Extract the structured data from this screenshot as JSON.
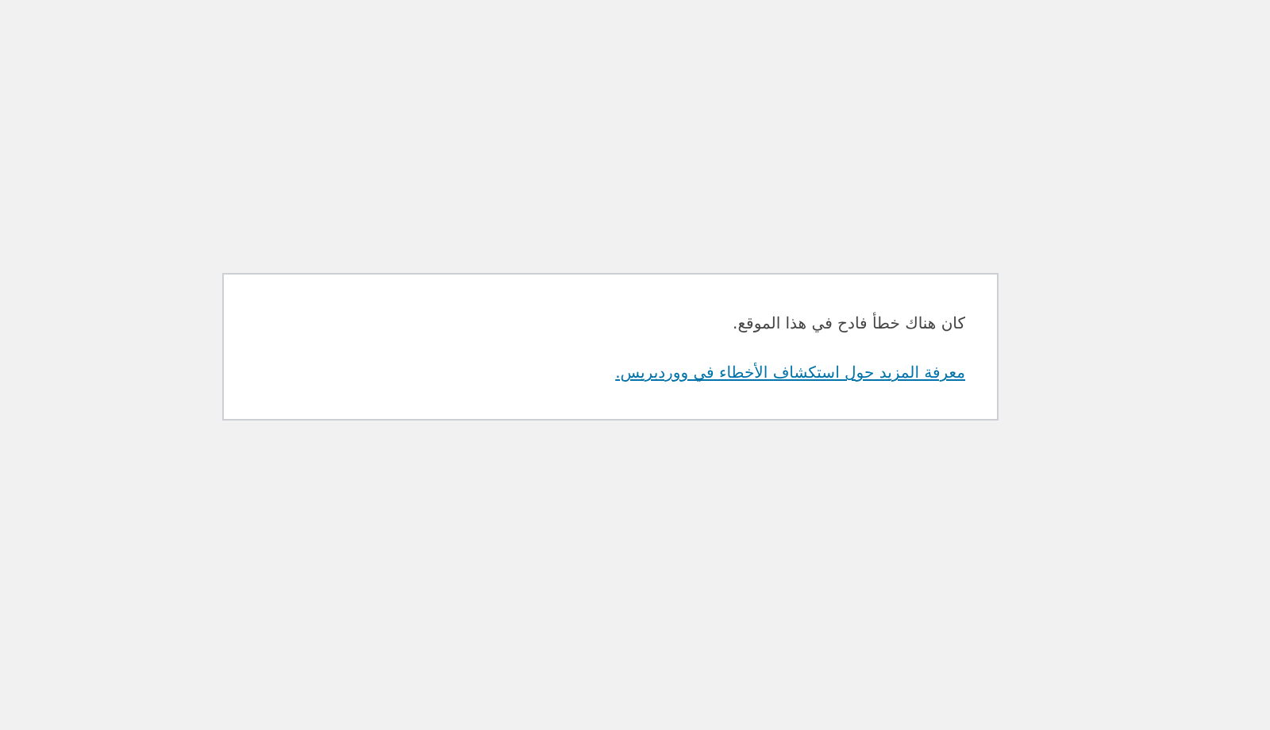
{
  "error_card": {
    "message": "كان هناك خطأ فادح في هذا الموقع.",
    "help_link": "معرفة المزيد حول استكشاف الأخطاء في ووردبريس."
  }
}
